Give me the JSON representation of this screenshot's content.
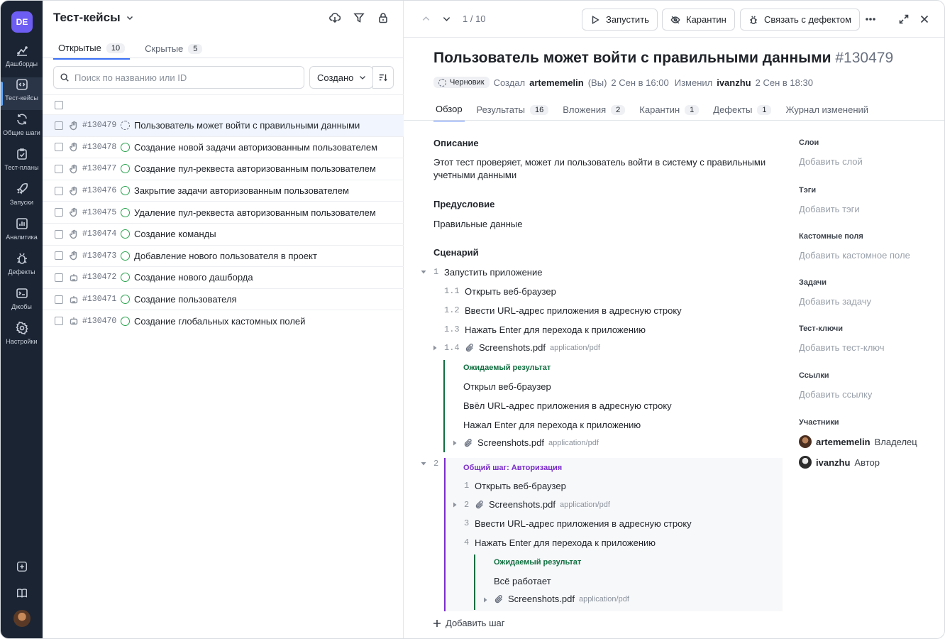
{
  "nav": {
    "logo": "DE",
    "items": [
      {
        "label": "Дашборды",
        "icon": "dashboard-icon"
      },
      {
        "label": "Тест-кейсы",
        "icon": "code-icon"
      },
      {
        "label": "Общие шаги",
        "icon": "refresh-icon"
      },
      {
        "label": "Тест-планы",
        "icon": "clipboard-icon"
      },
      {
        "label": "Запуски",
        "icon": "rocket-icon"
      },
      {
        "label": "Аналитика",
        "icon": "analytics-icon"
      },
      {
        "label": "Дефекты",
        "icon": "bug-icon"
      },
      {
        "label": "Джобы",
        "icon": "terminal-icon"
      },
      {
        "label": "Настройки",
        "icon": "gear-icon"
      }
    ]
  },
  "list": {
    "title": "Тест-кейсы",
    "tabs": [
      {
        "label": "Открытые",
        "count": "10"
      },
      {
        "label": "Скрытые",
        "count": "5"
      }
    ],
    "search_placeholder": "Поиск по названию или ID",
    "sort_label": "Создано",
    "rows": [
      {
        "id": "#130479",
        "title": "Пользователь может войти с правильными данными",
        "status": "draft",
        "type": "manual"
      },
      {
        "id": "#130478",
        "title": "Создание новой задачи авторизованным пользователем",
        "status": "active",
        "type": "manual"
      },
      {
        "id": "#130477",
        "title": "Создание пул-реквеста авторизованным пользователем",
        "status": "active",
        "type": "manual"
      },
      {
        "id": "#130476",
        "title": "Закрытие задачи авторизованным пользователем",
        "status": "active",
        "type": "manual"
      },
      {
        "id": "#130475",
        "title": "Удаление пул-реквеста авторизованным пользователем",
        "status": "active",
        "type": "manual"
      },
      {
        "id": "#130474",
        "title": "Создание команды",
        "status": "active",
        "type": "manual"
      },
      {
        "id": "#130473",
        "title": "Добавление нового пользователя в проект",
        "status": "active",
        "type": "manual"
      },
      {
        "id": "#130472",
        "title": "Создание нового дашборда",
        "status": "active",
        "type": "auto"
      },
      {
        "id": "#130471",
        "title": "Создание пользователя",
        "status": "active",
        "type": "auto"
      },
      {
        "id": "#130470",
        "title": "Создание глобальных кастомных полей",
        "status": "active",
        "type": "auto"
      }
    ]
  },
  "detail": {
    "pager": "1 / 10",
    "buttons": {
      "run": "Запустить",
      "quarantine": "Карантин",
      "link_defect": "Связать с дефектом"
    },
    "title": "Пользователь может войти с правильными данными",
    "number": "#130479",
    "status": "Черновик",
    "created_prefix": "Создал",
    "created_by": "artememelin",
    "created_you": "(Вы)",
    "created_at": "2 Сен в 16:00",
    "modified_prefix": "Изменил",
    "modified_by": "ivanzhu",
    "modified_at": "2 Сен в 18:30",
    "tabs": [
      {
        "label": "Обзор",
        "count": ""
      },
      {
        "label": "Результаты",
        "count": "16"
      },
      {
        "label": "Вложения",
        "count": "2"
      },
      {
        "label": "Карантин",
        "count": "1"
      },
      {
        "label": "Дефекты",
        "count": "1"
      },
      {
        "label": "Журнал изменений",
        "count": ""
      }
    ],
    "description_h": "Описание",
    "description_1": "Этот тест проверяет, может ли пользователь войти в систему с правильными",
    "description_2": "учетными данными",
    "precondition_h": "Предусловие",
    "precondition": "Правильные данные",
    "scenario_h": "Сценарий",
    "step1": {
      "num": "1",
      "text": "Запустить приложение",
      "sub": [
        {
          "num": "1.1",
          "text": "Открыть веб-браузер"
        },
        {
          "num": "1.2",
          "text": "Ввести URL-адрес приложения в адресную строку"
        },
        {
          "num": "1.3",
          "text": "Нажать Enter для перехода к приложению"
        }
      ],
      "file_num": "1.4",
      "file": "Screenshots.pdf",
      "mime": "application/pdf",
      "expected_label": "Ожидаемый результат",
      "expected": [
        "Открыл веб-браузер",
        "Ввёл URL-адрес приложения в адресную строку",
        "Нажал Enter для перехода к приложению"
      ],
      "expected_file": "Screenshots.pdf",
      "expected_mime": "application/pdf"
    },
    "step2": {
      "num": "2",
      "shared_label": "Общий шаг: Авторизация",
      "sub": [
        {
          "num": "1",
          "text": "Открыть веб-браузер"
        },
        {
          "num": "2",
          "text": "Screenshots.pdf",
          "mime": "application/pdf"
        },
        {
          "num": "3",
          "text": "Ввести URL-адрес приложения в адресную строку"
        },
        {
          "num": "4",
          "text": "Нажать Enter для перехода к приложению"
        }
      ],
      "expected_label": "Ожидаемый результат",
      "expected": "Всё работает",
      "expected_file": "Screenshots.pdf",
      "expected_mime": "application/pdf"
    },
    "add_step": "Добавить шаг",
    "side": [
      {
        "h": "Слои",
        "v": "Добавить слой"
      },
      {
        "h": "Тэги",
        "v": "Добавить тэги"
      },
      {
        "h": "Кастомные поля",
        "v": "Добавить кастомное поле"
      },
      {
        "h": "Задачи",
        "v": "Добавить задачу"
      },
      {
        "h": "Тест-ключи",
        "v": "Добавить тест-ключ"
      },
      {
        "h": "Ссылки",
        "v": "Добавить ссылку"
      }
    ],
    "members_h": "Участники",
    "members": [
      {
        "name": "artememelin",
        "role": "Владелец"
      },
      {
        "name": "ivanzhu",
        "role": "Автор"
      }
    ]
  },
  "colors": {
    "nav_bg": "#1b2433",
    "accent": "#3b6ff5",
    "logo": "#6e5df2",
    "success": "#2aa44f",
    "shared": "#7a2cc9",
    "expected": "#0f6e3f"
  }
}
